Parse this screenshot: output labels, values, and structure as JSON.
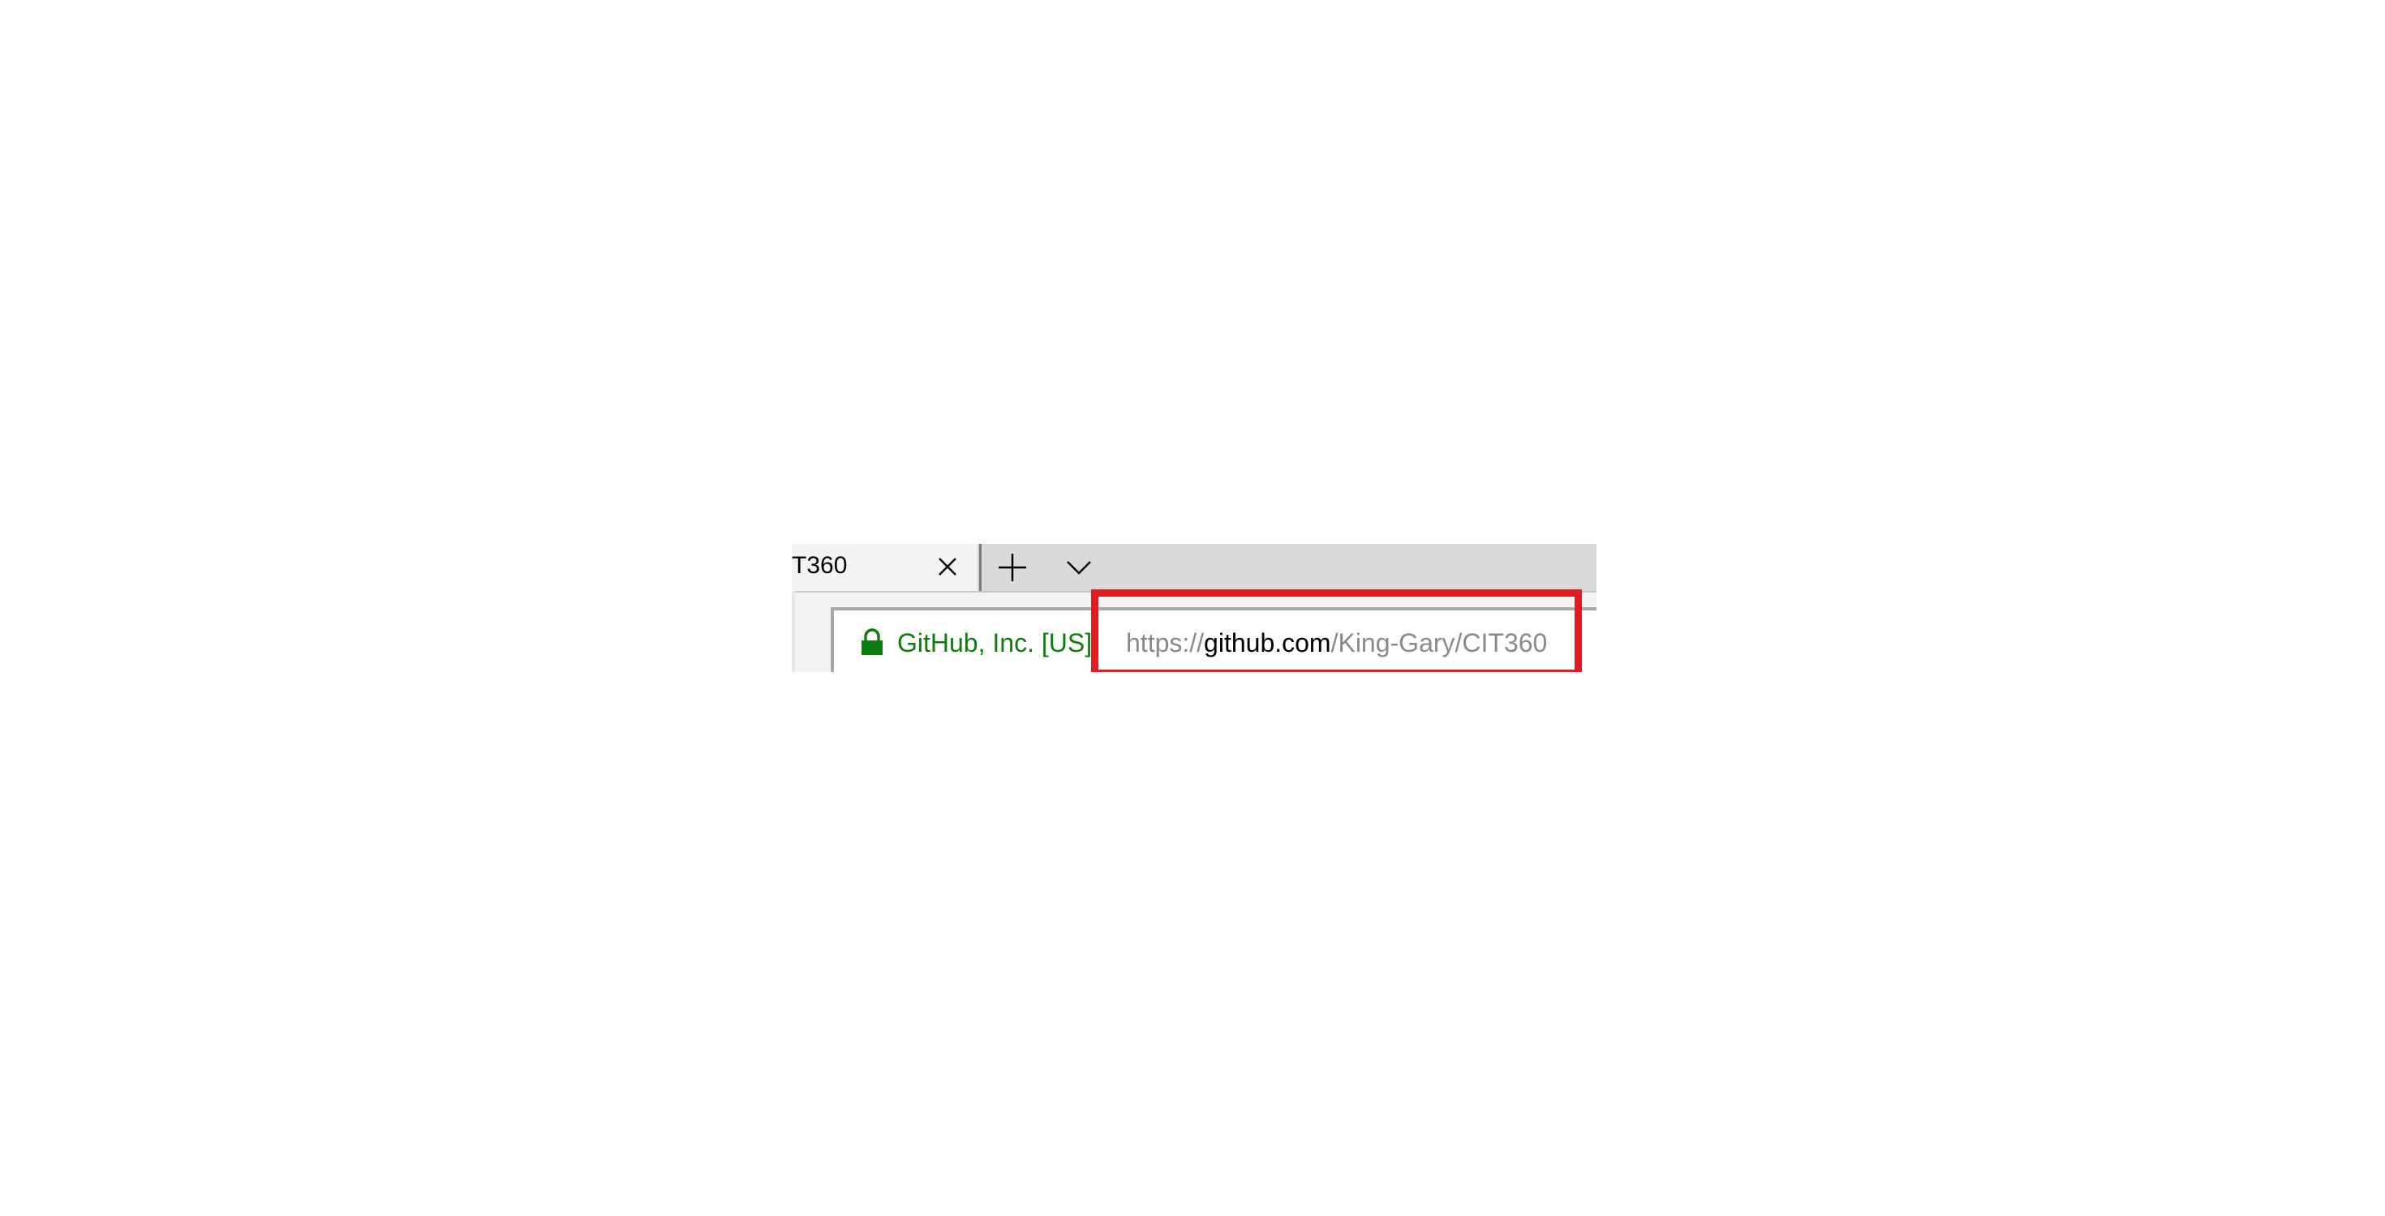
{
  "tab": {
    "title": "T360"
  },
  "address_bar": {
    "site_identity": "GitHub, Inc. [US]",
    "url_scheme": "https://",
    "url_host": "github.com",
    "url_path": "/King-Gary/CIT360"
  },
  "icons": {
    "tab_close": "close-icon",
    "new_tab": "plus-icon",
    "tab_list": "chevron-down-icon",
    "security": "lock-icon"
  },
  "colors": {
    "site_identity": "#107c10",
    "highlight": "#e11b22",
    "url_muted": "#8a8a8a",
    "url_host": "#000000"
  }
}
